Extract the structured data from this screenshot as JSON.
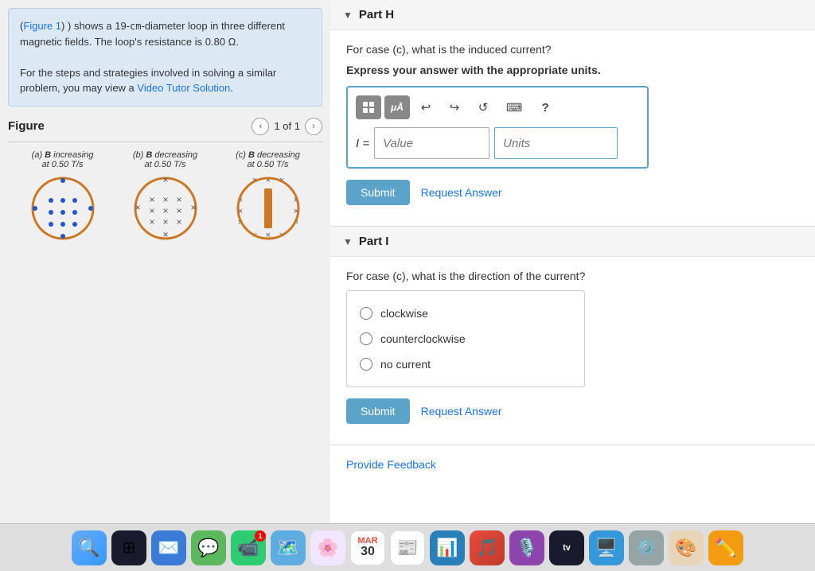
{
  "left": {
    "info": {
      "text1": "(",
      "figure_link": "Figure 1",
      "text2": ") shows a 19-",
      "cm_sup": "cm",
      "text3": "-diameter loop in three different magnetic fields. The loop's resistance is 0.80 ",
      "omega": "Ω",
      "text4": ".",
      "text5": "For the steps and strategies involved in solving a similar problem, you may view a ",
      "video_link": "Video Tutor Solution",
      "text6": "."
    },
    "figure": {
      "title": "Figure",
      "counter": "1 of 1",
      "items": [
        {
          "label_a": "(a) ",
          "label_b": "B",
          "label_c": " increasing",
          "label_d": "at 0.50 T/s",
          "type": "dots"
        },
        {
          "label_a": "(b) ",
          "label_b": "B",
          "label_c": " decreasing",
          "label_d": "at 0.50 T/s",
          "type": "crosses"
        },
        {
          "label_a": "(c) ",
          "label_b": "B",
          "label_c": " decreasing",
          "label_d": "at 0.50 T/s",
          "type": "bar"
        }
      ]
    }
  },
  "right": {
    "part_h": {
      "title": "Part H",
      "question": "For case (c), what is the induced current?",
      "express_text": "Express your answer with the appropriate units.",
      "math_input": {
        "label": "I =",
        "value_placeholder": "Value",
        "units_placeholder": "Units"
      },
      "toolbar": {
        "matrix_btn": "⊞",
        "mu_btn": "μÅ",
        "undo_btn": "↩",
        "redo_btn": "↪",
        "reset_btn": "↺",
        "keyboard_btn": "⌨",
        "help_btn": "?"
      },
      "submit_label": "Submit",
      "request_answer_label": "Request Answer"
    },
    "part_i": {
      "title": "Part I",
      "question": "For case (c), what is the direction of the current?",
      "options": [
        {
          "id": "clockwise",
          "label": "clockwise"
        },
        {
          "id": "counterclockwise",
          "label": "counterclockwise"
        },
        {
          "id": "no-current",
          "label": "no current"
        }
      ],
      "submit_label": "Submit",
      "request_answer_label": "Request Answer"
    },
    "feedback_label": "Provide Feedback"
  },
  "dock": {
    "icons": [
      {
        "emoji": "🔍",
        "name": "finder"
      },
      {
        "emoji": "📋",
        "name": "launchpad"
      },
      {
        "emoji": "📧",
        "name": "mail"
      },
      {
        "emoji": "💬",
        "name": "messages"
      },
      {
        "emoji": "📞",
        "name": "facetime"
      },
      {
        "emoji": "🗺️",
        "name": "maps"
      },
      {
        "emoji": "🖼️",
        "name": "photos"
      },
      {
        "emoji": "📅",
        "name": "calendar",
        "badge": "30"
      },
      {
        "emoji": "📰",
        "name": "news"
      },
      {
        "emoji": "📊",
        "name": "analytics"
      },
      {
        "emoji": "🎵",
        "name": "music"
      },
      {
        "emoji": "🎙️",
        "name": "podcasts"
      },
      {
        "emoji": "📺",
        "name": "tv"
      },
      {
        "emoji": "🖥️",
        "name": "desktop"
      },
      {
        "emoji": "⚙️",
        "name": "settings"
      },
      {
        "emoji": "🎨",
        "name": "art"
      },
      {
        "emoji": "✏️",
        "name": "notes"
      }
    ]
  }
}
